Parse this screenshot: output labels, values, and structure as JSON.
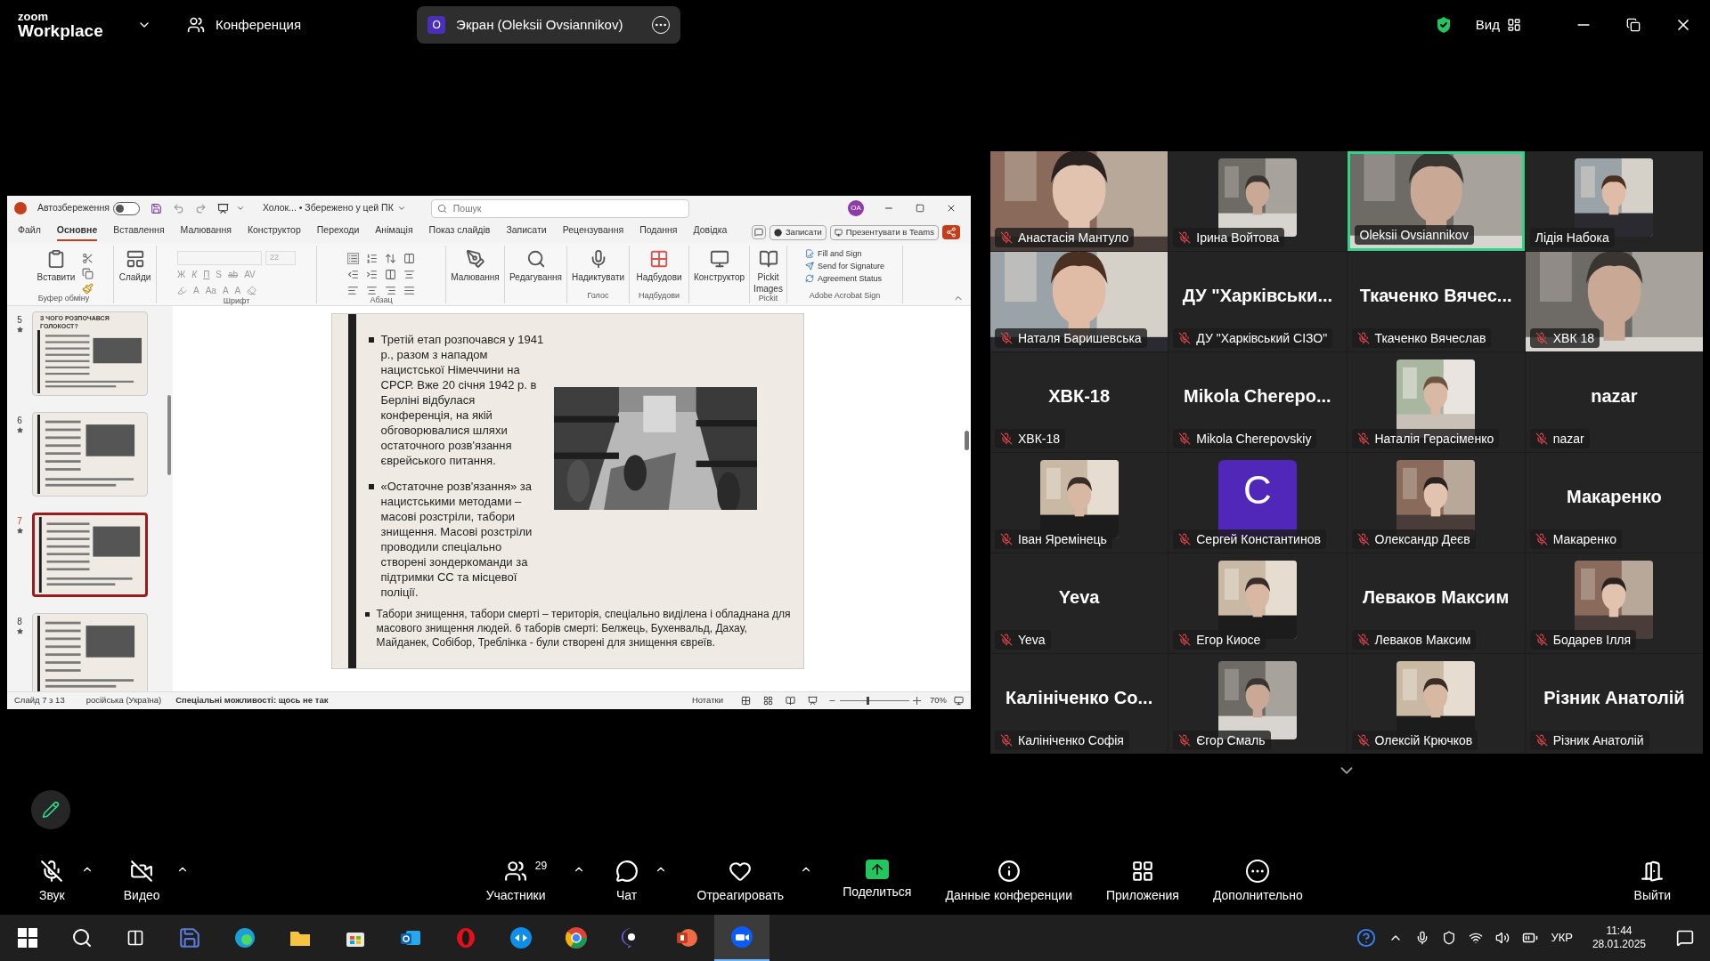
{
  "zoom_bar": {
    "logo_top": "zoom",
    "logo_bottom": "Workplace",
    "meeting_label": "Конференция",
    "share_pill": {
      "initial": "O",
      "label": "Экран (Oleksii Ovsiannikov)"
    },
    "view_label": "Вид"
  },
  "powerpoint": {
    "title_bar": {
      "autosave_label": "Автозбереження",
      "autosave_on": false,
      "file_name": "Холок... • Збережено у цей ПК",
      "search_placeholder": "Пошук",
      "user_initials": "OA"
    },
    "menu_tabs": [
      {
        "label": "Файл",
        "selected": false
      },
      {
        "label": "Основне",
        "selected": true
      },
      {
        "label": "Вставлення",
        "selected": false
      },
      {
        "label": "Малювання",
        "selected": false
      },
      {
        "label": "Конструктор",
        "selected": false
      },
      {
        "label": "Переходи",
        "selected": false
      },
      {
        "label": "Анімація",
        "selected": false
      },
      {
        "label": "Показ слайдів",
        "selected": false
      },
      {
        "label": "Записати",
        "selected": false
      },
      {
        "label": "Рецензування",
        "selected": false
      },
      {
        "label": "Подання",
        "selected": false
      },
      {
        "label": "Довідка",
        "selected": false
      }
    ],
    "menu_buttons": [
      "Записати",
      "Презентувати в Teams"
    ],
    "ribbon": [
      {
        "kind": "clipboard",
        "label": "Буфер обміну",
        "buttons": [
          "Вставити"
        ]
      },
      {
        "kind": "slides",
        "buttons": [
          "Слайди"
        ]
      },
      {
        "kind": "font",
        "label": "Шрифт",
        "size": "22",
        "row1": [
          "Ж",
          "К",
          "П",
          "S",
          "ab",
          "AV"
        ],
        "row2": [
          "A",
          "Aa",
          "A",
          "A"
        ]
      },
      {
        "kind": "paragraph",
        "label": "Абзац"
      },
      {
        "kind": "draw",
        "buttons": [
          "Малювання"
        ]
      },
      {
        "kind": "edit",
        "buttons": [
          "Редагування"
        ]
      },
      {
        "kind": "voice",
        "label": "Голос",
        "buttons": [
          "Надиктувати"
        ]
      },
      {
        "kind": "addins",
        "label": "Надбудови",
        "buttons": [
          "Надбудови"
        ]
      },
      {
        "kind": "designer",
        "buttons": [
          "Конструктор"
        ]
      },
      {
        "kind": "pickit",
        "label": "Pickit",
        "buttons": [
          "Pickit Images"
        ]
      },
      {
        "kind": "sign",
        "label": "Adobe Acrobat Sign",
        "buttons": [
          "Fill and Sign",
          "Send for Signature",
          "Agreement Status"
        ]
      }
    ],
    "thumbnails": [
      {
        "number": "5",
        "title": "З ЧОГО РОЗПОЧАВСЯ ГОЛОКОСТ?",
        "selected": false
      },
      {
        "number": "6",
        "selected": false
      },
      {
        "number": "7",
        "selected": true
      },
      {
        "number": "8",
        "selected": false
      }
    ],
    "slide": {
      "bullets": [
        {
          "kind": "beside",
          "text": "Третій етап розпочався у 1941 р., разом з нападом нацистської Німеччини на СРСР. Вже 20 січня 1942 р. в Берліні відбулася конференція, на якій обговорювалися шляхи остаточного розв'язання єврейського питання."
        },
        {
          "kind": "beside",
          "text": "«Остаточне розв'язання» за нацистськими методами – масові розстріли, табори знищення. Масові розстріли проводили спеціально створені зондеркоманди за підтримки СС та місцевої поліції."
        },
        {
          "kind": "wide",
          "text": "Табори знищення, табори смерті – територія, спеціально виділена і обладнана для масового знищення людей. 6 таборів смерті: Белжець, Бухенвальд, Дахау, Майданек, Собібор, Треблінка - були створені для знищення євреїв."
        }
      ]
    },
    "status_bar": {
      "slide_counter": "Слайд 7 з 13",
      "language": "російська (Україна)",
      "accessibility": "Спеціальні можливості: щось не так",
      "notes": "Нотатки",
      "zoom": "70%",
      "zoom_slider": {
        "level": 0.38
      }
    }
  },
  "participants": [
    {
      "name": "Анастасія Мантуло",
      "kind": "video",
      "muted": true,
      "active_speaker": false
    },
    {
      "name": "Ірина Войтова",
      "muted": true,
      "active_speaker": false
    },
    {
      "name": "Oleksii Ovsiannikov",
      "kind": "video",
      "muted": false,
      "active_speaker": true
    },
    {
      "name": "Лідія Набока",
      "muted": false,
      "active_speaker": false
    },
    {
      "name": "Наталя Баришевська",
      "kind": "video",
      "muted": true,
      "active_speaker": false
    },
    {
      "name": "ДУ \"Харківський СІЗО\"",
      "kind": "name",
      "tile_text": "ДУ \"Харківськи...",
      "muted": true,
      "active_speaker": false
    },
    {
      "name": "Ткаченко Вячеслав",
      "kind": "name",
      "tile_text": "Ткаченко Вячес...",
      "muted": true,
      "active_speaker": false
    },
    {
      "name": "ХВК 18",
      "kind": "video",
      "muted": true,
      "active_speaker": false
    },
    {
      "name": "ХВК-18",
      "kind": "name",
      "tile_text": "ХВК-18",
      "muted": true,
      "active_speaker": false
    },
    {
      "name": "Mikola Cherepovskiy",
      "kind": "name",
      "tile_text": "Mikola Cherepo...",
      "muted": true,
      "active_speaker": false
    },
    {
      "name": "Наталія Герасіменко",
      "muted": true,
      "active_speaker": false
    },
    {
      "name": "nazar",
      "kind": "name",
      "tile_text": "nazar",
      "muted": true,
      "active_speaker": false
    },
    {
      "name": "Іван Яремінець",
      "muted": true,
      "active_speaker": false
    },
    {
      "name": "Сергей Константинов",
      "kind": "avatar",
      "tile_text": "C",
      "muted": true,
      "active_speaker": false
    },
    {
      "name": "Олександр Деєв",
      "muted": true,
      "active_speaker": false
    },
    {
      "name": "Макаренко",
      "kind": "name",
      "tile_text": "Макаренко",
      "muted": true,
      "active_speaker": false
    },
    {
      "name": "Yeva",
      "kind": "name",
      "tile_text": "Yeva",
      "muted": true,
      "active_speaker": false
    },
    {
      "name": "Егор Киосе",
      "muted": true,
      "active_speaker": false
    },
    {
      "name": "Леваков Максим",
      "kind": "name",
      "tile_text": "Леваков Максим",
      "muted": true,
      "active_speaker": false
    },
    {
      "name": "Бодарев Ілля",
      "muted": true,
      "active_speaker": false
    },
    {
      "name": "Калініченко Софія",
      "kind": "name",
      "tile_text": "Калініченко Со...",
      "muted": true,
      "active_speaker": false
    },
    {
      "name": "Єгор Смаль",
      "muted": true,
      "active_speaker": false
    },
    {
      "name": "Олексій Крючков",
      "muted": true,
      "active_speaker": false
    },
    {
      "name": "Різник Анатолій",
      "kind": "name",
      "tile_text": "Різник Анатолій",
      "muted": true,
      "active_speaker": false
    }
  ],
  "toolbar": [
    {
      "kind": "audio",
      "label": "Звук",
      "off": true,
      "caret": true
    },
    {
      "kind": "video",
      "label": "Видео",
      "off": true,
      "caret": true
    },
    {
      "kind": "participants",
      "label": "Участники",
      "count": "29",
      "caret": true
    },
    {
      "kind": "chat",
      "label": "Чат",
      "caret": true
    },
    {
      "kind": "react",
      "label": "Отреагировать",
      "caret": true
    },
    {
      "kind": "share",
      "label": "Поделиться",
      "caret": false
    },
    {
      "kind": "info",
      "label": "Данные конференции",
      "caret": false
    },
    {
      "kind": "apps",
      "label": "Приложения",
      "caret": false
    },
    {
      "kind": "more",
      "label": "Дополнительно",
      "caret": false
    },
    {
      "kind": "leave",
      "label": "Выйти",
      "caret": false
    }
  ],
  "taskbar": {
    "apps": [
      {
        "kind": "disk",
        "selected": false
      },
      {
        "kind": "swirl",
        "selected": false
      },
      {
        "kind": "folder",
        "selected": false
      },
      {
        "kind": "bag",
        "selected": false
      },
      {
        "kind": "envelope",
        "selected": false
      },
      {
        "kind": "ring",
        "selected": false
      },
      {
        "kind": "arrows",
        "selected": false
      },
      {
        "kind": "orb",
        "selected": false
      },
      {
        "kind": "bubble",
        "selected": false
      },
      {
        "kind": "slides",
        "selected": false
      },
      {
        "kind": "camera",
        "selected": true
      }
    ],
    "language": "УКР",
    "time": "11:44",
    "date": "28.01.2025"
  }
}
